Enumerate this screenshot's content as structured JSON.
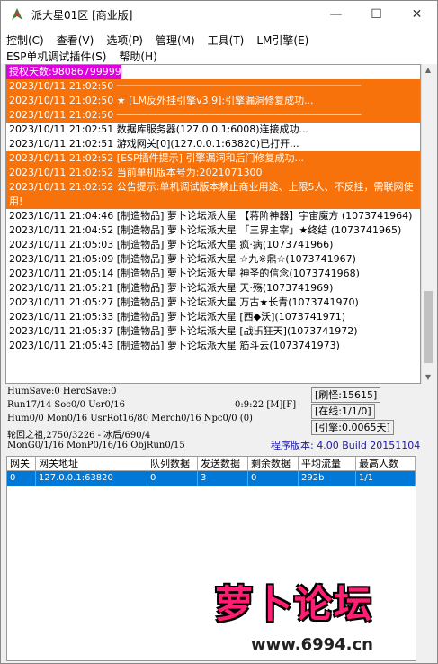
{
  "window": {
    "title": "派大星01区 [商业版]"
  },
  "controls": {
    "minimize": "—",
    "maximize": "☐",
    "close": "✕"
  },
  "menu": {
    "row1": [
      "控制(C)",
      "查看(V)",
      "选项(P)",
      "管理(M)",
      "工具(T)",
      "LM引擎(E)"
    ],
    "row2": [
      "ESP单机调试插件(S)",
      "帮助(H)"
    ]
  },
  "log": [
    {
      "text": "授权天数:98086799999",
      "style": "magenta"
    },
    {
      "text": "2023/10/11 21:02:50 ─────────────────────────────────────────",
      "style": "orange"
    },
    {
      "text": "2023/10/11 21:02:50 ★ [LM反外挂引擎v3.9]:引擎漏洞修复成功...",
      "style": "orange"
    },
    {
      "text": "2023/10/11 21:02:50 ─────────────────────────────────────────",
      "style": "orange"
    },
    {
      "text": "2023/10/11 21:02:51 数据库服务器(127.0.0.1:6008)连接成功...",
      "style": "normal"
    },
    {
      "text": "2023/10/11 21:02:51 游戏网关[0](127.0.0.1:63820)已打开...",
      "style": "normal"
    },
    {
      "text": "2023/10/11 21:02:52 [ESP插件提示] 引擎漏洞和后门修复成功...",
      "style": "orange"
    },
    {
      "text": "2023/10/11 21:02:52 当前单机版本号为:2021071300",
      "style": "orange"
    },
    {
      "text": "2023/10/11 21:02:52 公告提示:单机调试版本禁止商业用途、上限5人、不反挂，需联网使用!",
      "style": "orange-wrap"
    },
    {
      "text": "2023/10/11 21:04:46 [制造物品] 萝卜论坛派大星 【蒋阶神器】宇宙魔方 (1073741964)",
      "style": "wrap"
    },
    {
      "text": "2023/10/11 21:04:52 [制造物品] 萝卜论坛派大星 「三界主宰」★终结 (1073741965)",
      "style": "wrap"
    },
    {
      "text": "2023/10/11 21:05:03 [制造物品] 萝卜论坛派大星 疯·病(1073741966)",
      "style": "normal"
    },
    {
      "text": "2023/10/11 21:05:09 [制造物品] 萝卜论坛派大星 ☆九※鼎☆(1073741967)",
      "style": "normal"
    },
    {
      "text": "2023/10/11 21:05:14 [制造物品] 萝卜论坛派大星 神圣的信念(1073741968)",
      "style": "normal"
    },
    {
      "text": "2023/10/11 21:05:21 [制造物品] 萝卜论坛派大星 天·殇(1073741969)",
      "style": "normal"
    },
    {
      "text": "2023/10/11 21:05:27 [制造物品] 萝卜论坛派大星 万古★长青(1073741970)",
      "style": "normal"
    },
    {
      "text": "2023/10/11 21:05:33 [制造物品] 萝卜论坛派大星 [西◆沃](1073741971)",
      "style": "normal"
    },
    {
      "text": "2023/10/11 21:05:37 [制造物品] 萝卜论坛派大星 [战卐狂天](1073741972)",
      "style": "normal"
    },
    {
      "text": "2023/10/11 21:05:43 [制造物品] 萝卜论坛派大星 筋斗云(1073741973)",
      "style": "normal"
    }
  ],
  "status": {
    "line1": "HumSave:0 HeroSave:0",
    "line2": "Run17/14 Soc0/0 Usr0/16",
    "time": "0:9:22 [M][F]",
    "line3": "Hum0/0 Mon0/16 UsrRot16/80 Merch0/16 Npc0/0 (0)",
    "line4": "轮回之祖,2750/3226 - 冰后/690/4",
    "line5": "MonG0/1/16 MonP0/16/16 ObjRun0/15",
    "refresh": "[刷怪:15615]",
    "online": "[在线:1/1/0]",
    "engine": "[引擎:0.0065天]",
    "version": "程序版本: 4.00 Build 20151104"
  },
  "table": {
    "headers": [
      "网关",
      "网关地址",
      "队列数据",
      "发送数据",
      "剩余数据",
      "平均流量",
      "最高人数"
    ],
    "rows": [
      [
        "0",
        "127.0.0.1:63820",
        "0",
        "3",
        "0",
        "292b",
        "1/1"
      ]
    ]
  },
  "watermark": {
    "title": "萝卜论坛",
    "url": "www.6994.cn"
  },
  "colors": {
    "highlight": "#f7720a",
    "selection": "#0078d7",
    "magenta": "#e000e0"
  }
}
